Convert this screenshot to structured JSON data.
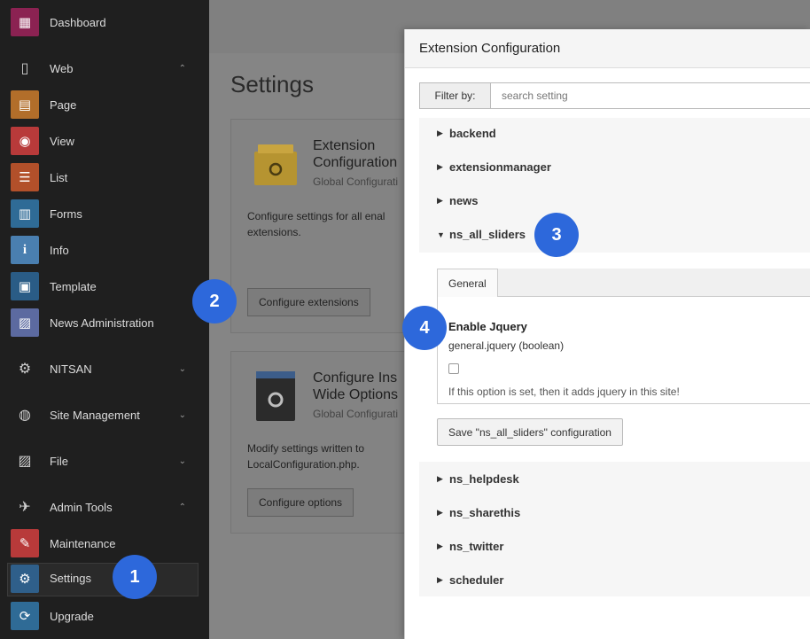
{
  "sidebar": {
    "items": [
      {
        "label": "Dashboard",
        "icon": "dashboard-icon",
        "color": "#8b2252",
        "glyph": "▦"
      },
      {
        "label": "Web",
        "icon": "file-icon",
        "chevron": "up"
      },
      {
        "label": "Page",
        "icon": "page-icon",
        "color": "#b26e2a",
        "glyph": "▤"
      },
      {
        "label": "View",
        "icon": "eye-icon",
        "color": "#b83a3a",
        "glyph": "◉"
      },
      {
        "label": "List",
        "icon": "list-icon",
        "color": "#b2502a",
        "glyph": "☰"
      },
      {
        "label": "Forms",
        "icon": "forms-icon",
        "color": "#2f6b96",
        "glyph": "▥"
      },
      {
        "label": "Info",
        "icon": "info-icon",
        "color": "#4a7fb0",
        "glyph": "i"
      },
      {
        "label": "Template",
        "icon": "template-icon",
        "color": "#2a5c86",
        "glyph": "▣"
      },
      {
        "label": "News Administration",
        "icon": "news-icon",
        "color": "#5c6aa0",
        "glyph": "▨"
      },
      {
        "label": "NITSAN",
        "icon": "gear-icon",
        "chevron": "down"
      },
      {
        "label": "Site Management",
        "icon": "globe-icon",
        "chevron": "down"
      },
      {
        "label": "File",
        "icon": "image-icon",
        "chevron": "down"
      },
      {
        "label": "Admin Tools",
        "icon": "rocket-icon",
        "chevron": "up"
      },
      {
        "label": "Maintenance",
        "icon": "wrench-icon",
        "color": "#b83a3a",
        "glyph": "✎"
      },
      {
        "label": "Settings",
        "icon": "settings-icon",
        "color": "#2f5f8a",
        "glyph": "⚙"
      },
      {
        "label": "Upgrade",
        "icon": "upgrade-icon",
        "color": "#2f6b96",
        "glyph": "⟳"
      }
    ]
  },
  "main": {
    "title": "Settings",
    "cards": [
      {
        "title_line1": "Extension",
        "title_line2": "Configuration",
        "subtitle": "Global Configurati",
        "desc": "Configure settings for all enal extensions.",
        "button": "Configure extensions"
      },
      {
        "title_line1": "Configure Ins",
        "title_line2": "Wide Options",
        "subtitle": "Global Configurati",
        "desc": "Modify settings written to LocalConfiguration.php.",
        "button": "Configure options"
      }
    ]
  },
  "modal": {
    "title": "Extension Configuration",
    "filter_label": "Filter by:",
    "filter_placeholder": "search setting",
    "extensions_top": [
      "backend",
      "extensionmanager",
      "news"
    ],
    "expanded_extension": "ns_all_sliders",
    "tab_label": "General",
    "option": {
      "title": "Enable Jquery",
      "key": "general.jquery (boolean)",
      "checked": false,
      "help": "If this option is set, then it adds jquery in this site!"
    },
    "save_button": "Save \"ns_all_sliders\" configuration",
    "extensions_bottom": [
      "ns_helpdesk",
      "ns_sharethis",
      "ns_twitter",
      "scheduler"
    ]
  },
  "markers": [
    "1",
    "2",
    "3",
    "4"
  ],
  "colors": {
    "marker": "#2d68db",
    "sidebar_bg": "#1f1f1f"
  }
}
